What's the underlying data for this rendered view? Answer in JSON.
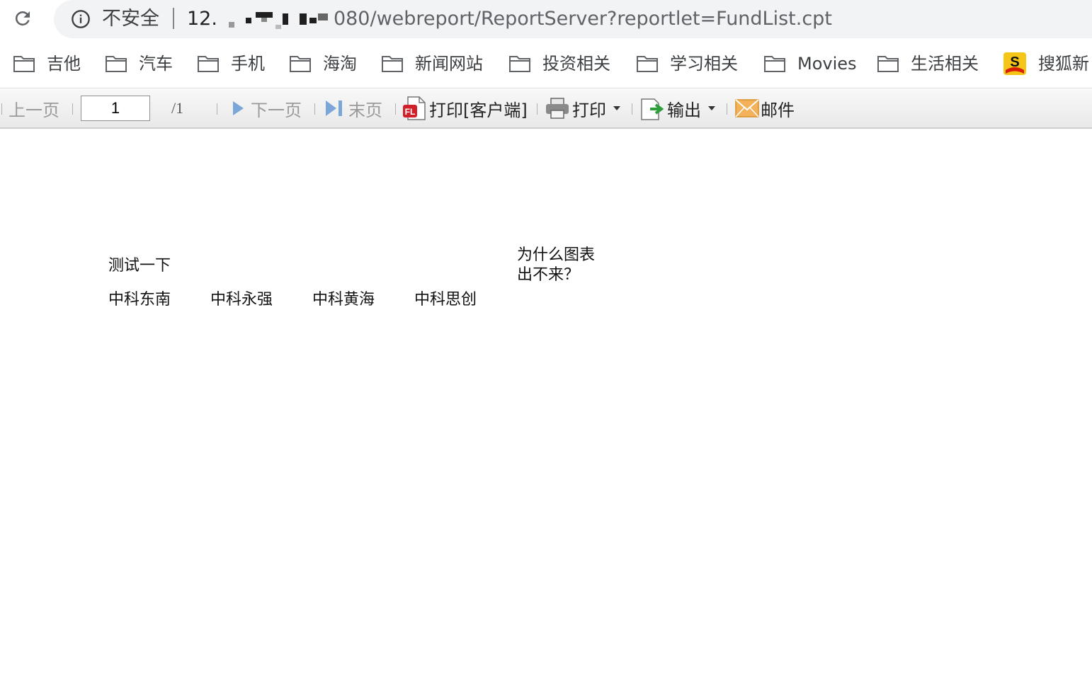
{
  "browser": {
    "security_label": "不安全",
    "url_host": "12.",
    "url_path": "080/webreport/ReportServer?reportlet=FundList.cpt"
  },
  "bookmarks": [
    {
      "label": "吉他",
      "icon": "folder-icon"
    },
    {
      "label": "汽车",
      "icon": "folder-icon"
    },
    {
      "label": "手机",
      "icon": "folder-icon"
    },
    {
      "label": "海淘",
      "icon": "folder-icon"
    },
    {
      "label": "新闻网站",
      "icon": "folder-icon"
    },
    {
      "label": "投资相关",
      "icon": "folder-icon"
    },
    {
      "label": "学习相关",
      "icon": "folder-icon"
    },
    {
      "label": "Movies",
      "icon": "folder-icon"
    },
    {
      "label": "生活相关",
      "icon": "folder-icon"
    },
    {
      "label": "搜狐新",
      "icon": "sohu-icon"
    }
  ],
  "toolbar": {
    "prev_label": "上一页",
    "page_value": "1",
    "page_total": "/1",
    "next_label": "下一页",
    "last_label": "末页",
    "client_print_label": "打印[客户端]",
    "print_label": "打印",
    "export_label": "输出",
    "mail_label": "邮件"
  },
  "report": {
    "title_cell": "测试一下",
    "note_cell": "为什么图表出不来？",
    "funds": [
      "中科东南",
      "中科永强",
      "中科黄海",
      "中科思创"
    ]
  }
}
